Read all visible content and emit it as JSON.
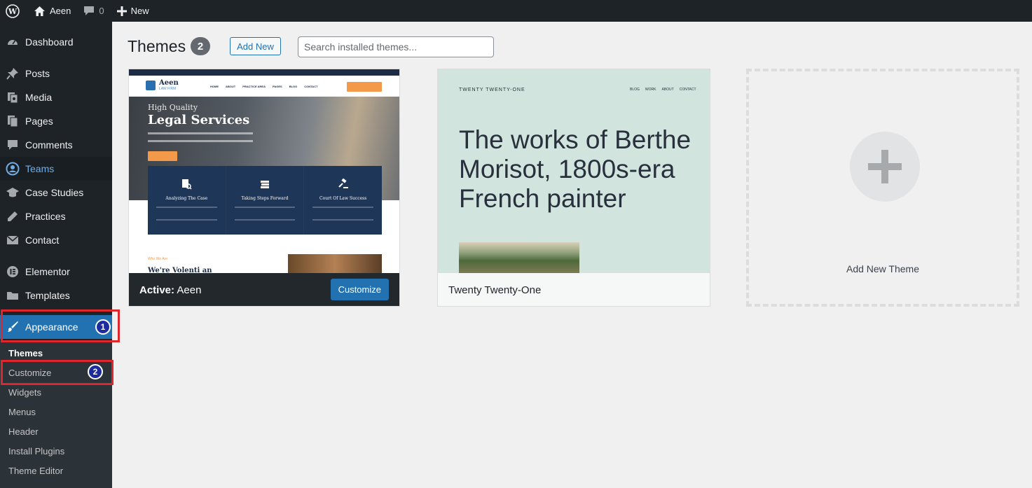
{
  "adminbar": {
    "site_name": "Aeen",
    "comments_count": "0",
    "new_label": "New"
  },
  "sidebar": {
    "items": [
      {
        "label": "Dashboard",
        "icon": "dashboard-icon"
      },
      {
        "label": "Posts",
        "icon": "pushpin-icon"
      },
      {
        "label": "Media",
        "icon": "media-icon"
      },
      {
        "label": "Pages",
        "icon": "pages-icon"
      },
      {
        "label": "Comments",
        "icon": "comment-icon"
      },
      {
        "label": "Teams",
        "icon": "teams-icon"
      },
      {
        "label": "Case Studies",
        "icon": "graduation-cap-icon"
      },
      {
        "label": "Practices",
        "icon": "pencil-icon"
      },
      {
        "label": "Contact",
        "icon": "envelope-icon"
      },
      {
        "label": "Elementor",
        "icon": "elementor-icon"
      },
      {
        "label": "Templates",
        "icon": "folder-icon"
      },
      {
        "label": "Appearance",
        "icon": "paintbrush-icon"
      }
    ],
    "submenu": [
      "Themes",
      "Customize",
      "Widgets",
      "Menus",
      "Header",
      "Install Plugins",
      "Theme Editor"
    ],
    "badges": [
      "1",
      "2"
    ]
  },
  "main": {
    "title": "Themes",
    "count": "2",
    "add_new_label": "Add New",
    "search_placeholder": "Search installed themes...",
    "themes": [
      {
        "active_prefix": "Active:",
        "name": "Aeen",
        "customize_label": "Customize",
        "preview": {
          "logo_title": "Aeen",
          "logo_sub": "LAW FIRM",
          "nav": [
            "HOME",
            "ABOUT",
            "PRACTICE AREA",
            "PAGES",
            "BLOG",
            "CONTACT"
          ],
          "hero_small": "High Quality",
          "hero_big": "Legal Services",
          "boxes": [
            "Analyzing The Case",
            "Taking Steps Forward",
            "Court Of Law Success"
          ],
          "who_we_are": "Who We Are",
          "we_are": "We're Volenti an"
        }
      },
      {
        "name": "Twenty Twenty-One",
        "preview": {
          "site_title": "TWENTY TWENTY-ONE",
          "nav": [
            "BLOG",
            "WORK",
            "ABOUT",
            "CONTACT"
          ],
          "headline": "The works of Berthe Morisot, 1800s-era French painter"
        }
      }
    ],
    "add_new_theme_label": "Add New Theme"
  },
  "colors": {
    "admin_dark": "#1d2327",
    "accent_blue": "#2271b1",
    "highlight_red": "#e0262d"
  }
}
